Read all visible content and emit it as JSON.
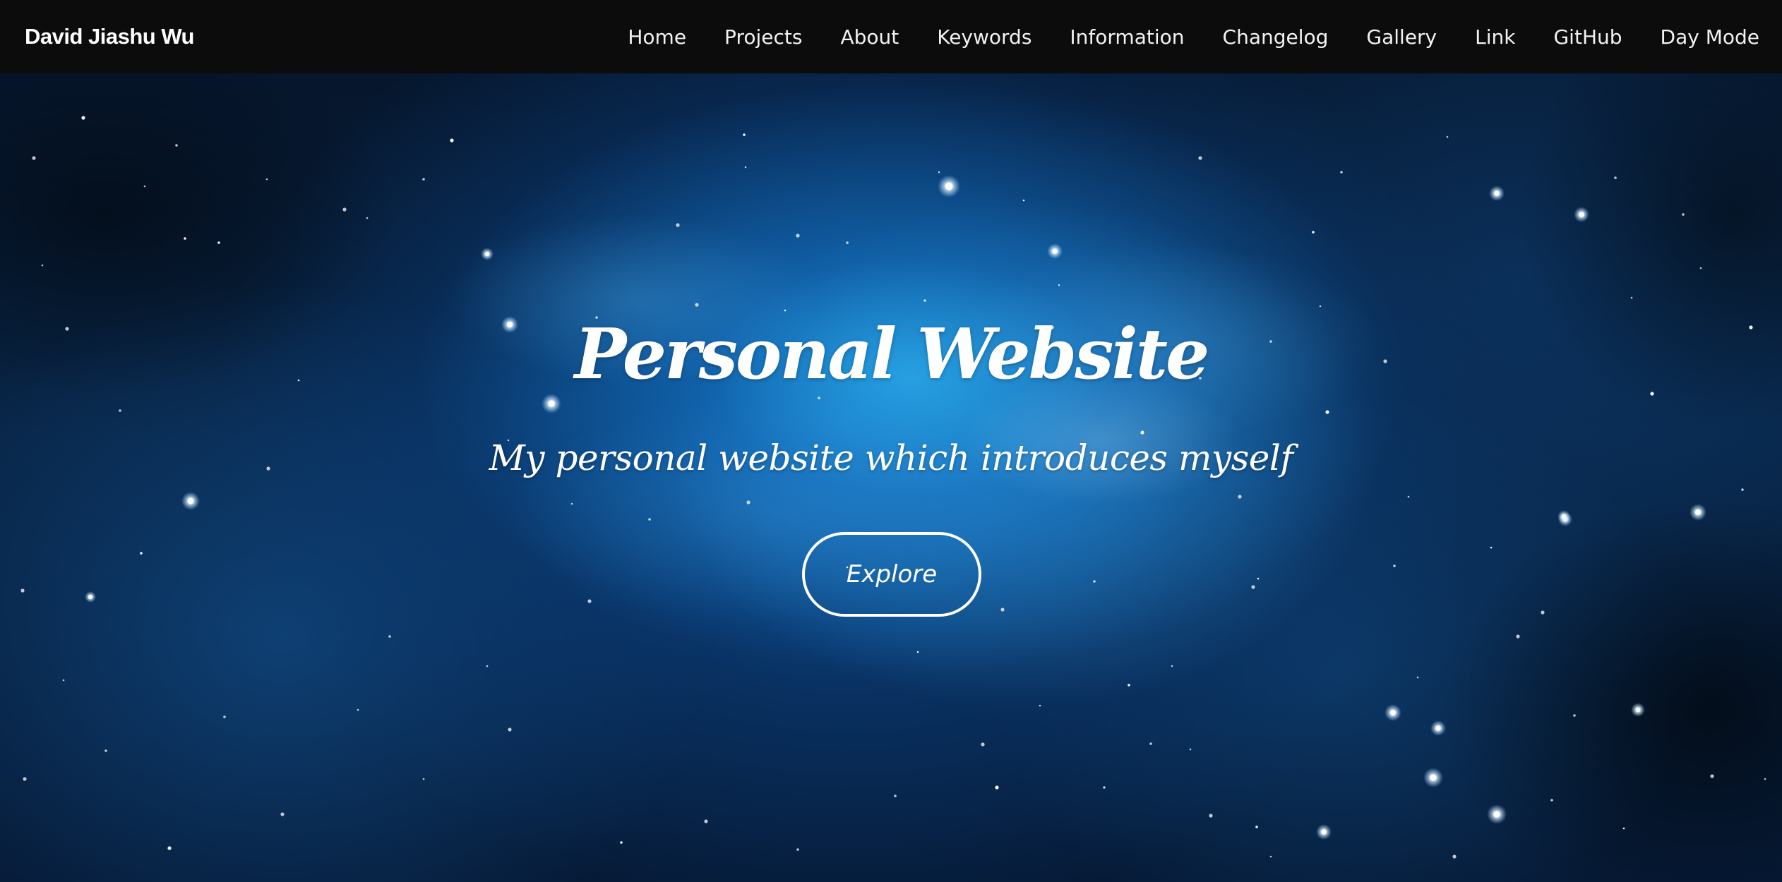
{
  "navbar": {
    "brand": "David Jiashu Wu",
    "items": [
      {
        "label": "Home"
      },
      {
        "label": "Projects"
      },
      {
        "label": "About"
      },
      {
        "label": "Keywords"
      },
      {
        "label": "Information"
      },
      {
        "label": "Changelog"
      },
      {
        "label": "Gallery"
      },
      {
        "label": "Link"
      },
      {
        "label": "GitHub"
      },
      {
        "label": "Day Mode"
      }
    ]
  },
  "hero": {
    "title": "Personal Website",
    "subtitle": "My personal website which introduces myself",
    "button_label": "Explore",
    "background": "starry-nebula-image"
  },
  "colors": {
    "navbar_background": "#0c0c0c",
    "nav_text": "#f2f2f2",
    "hero_text": "#ffffff",
    "nebula_blue": "#1f8fe0",
    "space_dark": "#06162c"
  }
}
